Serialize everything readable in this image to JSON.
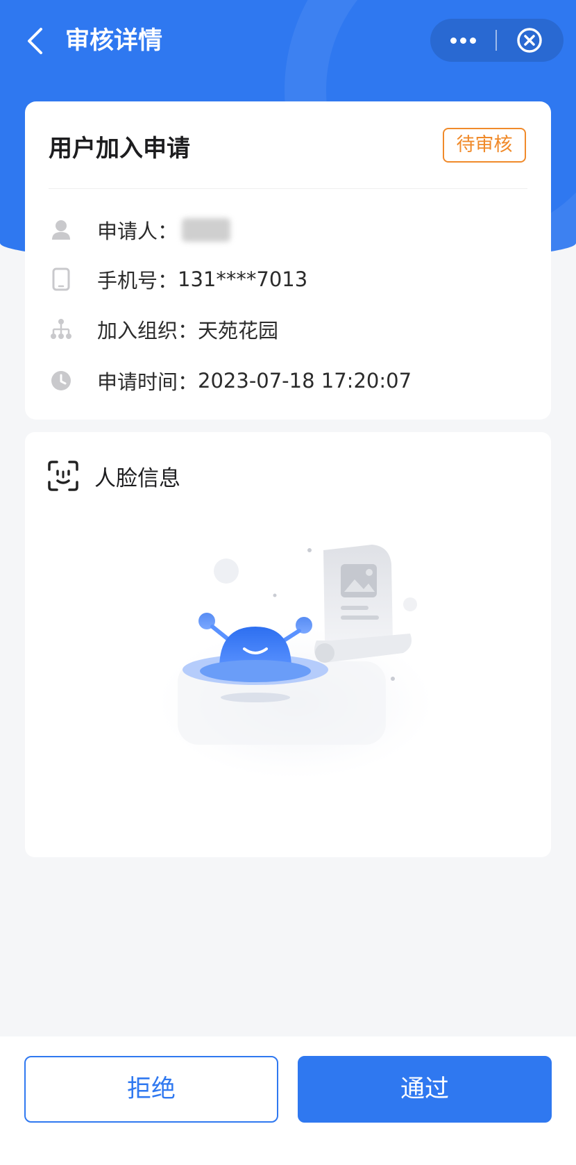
{
  "nav": {
    "title": "审核详情",
    "back_icon": "chevron-left-icon",
    "more_icon": "more-dots-icon",
    "close_icon": "close-circle-icon"
  },
  "application": {
    "title": "用户加入申请",
    "status": "待审核",
    "status_color": "#f08a2a",
    "fields": [
      {
        "icon": "user-icon",
        "label": "申请人：",
        "value": ""
      },
      {
        "icon": "phone-icon",
        "label": "手机号：",
        "value": "131****7013"
      },
      {
        "icon": "org-tree-icon",
        "label": "加入组织：",
        "value": "天苑花园"
      },
      {
        "icon": "clock-icon",
        "label": "申请时间：",
        "value": "2023-07-18 17:20:07"
      }
    ]
  },
  "face": {
    "title": "人脸信息",
    "icon": "face-scan-icon",
    "empty_illustration": "empty-state-illustration"
  },
  "actions": {
    "reject_label": "拒绝",
    "pass_label": "通过"
  },
  "colors": {
    "primary": "#2f78f0",
    "background": "#f5f6f8"
  }
}
